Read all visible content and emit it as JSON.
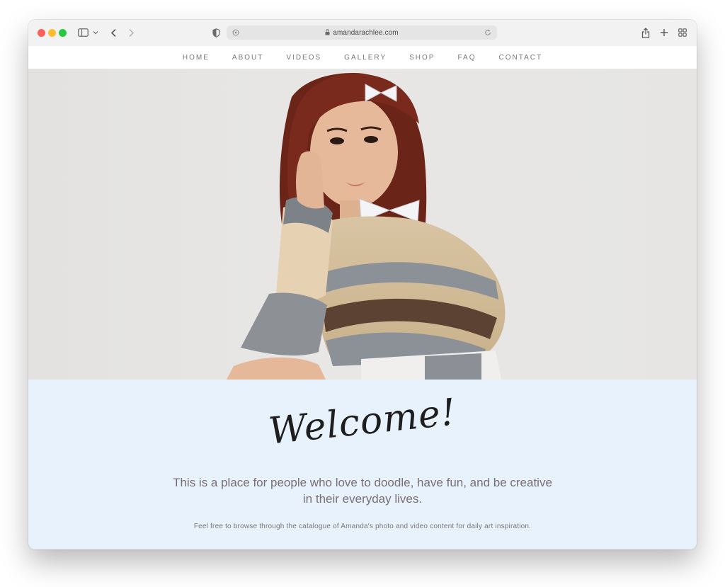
{
  "browser": {
    "url": "amandarachlee.com"
  },
  "nav": {
    "items": [
      "HOME",
      "ABOUT",
      "VIDEOS",
      "GALLERY",
      "SHOP",
      "FAQ",
      "CONTACT"
    ]
  },
  "welcome": {
    "title": "Welcome!",
    "lead": "This is a place for people who love to doodle, have fun, and be creative in their everyday lives.",
    "sub": "Feel free to browse through the catalogue of Amanda's photo and video content for daily art inspiration."
  },
  "colors": {
    "welcome_bg": "#e8f2fc",
    "hero_bg": "#e6e5e3"
  }
}
